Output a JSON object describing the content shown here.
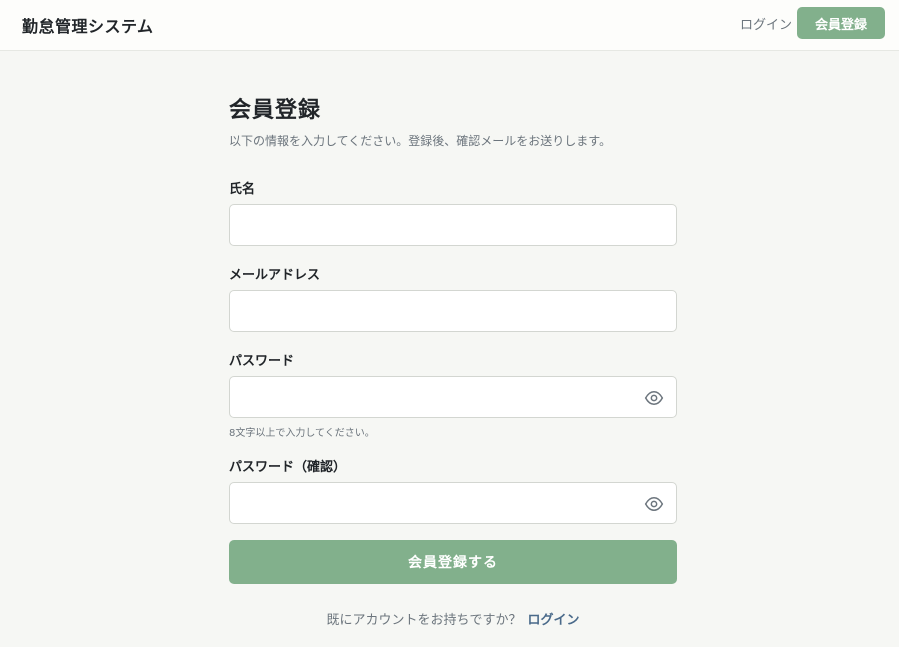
{
  "header": {
    "brand": "勤怠管理システム",
    "login_link": "ログイン",
    "register_button": "会員登録"
  },
  "form": {
    "title": "会員登録",
    "subtitle": "以下の情報を入力してください。登録後、確認メールをお送りします。",
    "fields": [
      {
        "label": "氏名",
        "value": "",
        "placeholder": ""
      },
      {
        "label": "メールアドレス",
        "value": "",
        "placeholder": ""
      },
      {
        "label": "パスワード",
        "value": "",
        "placeholder": "",
        "hint": "8文字以上で入力してください。",
        "icon": "eye-icon"
      },
      {
        "label": "パスワード（確認）",
        "value": "",
        "placeholder": "",
        "icon": "eye-icon"
      }
    ],
    "submit_label": "会員登録する",
    "footer_text": "既にアカウントをお持ちですか？",
    "footer_link": "ログイン"
  },
  "colors": {
    "accent": "#82b08c",
    "link": "#4a6a8a",
    "background": "#f6f7f4"
  }
}
